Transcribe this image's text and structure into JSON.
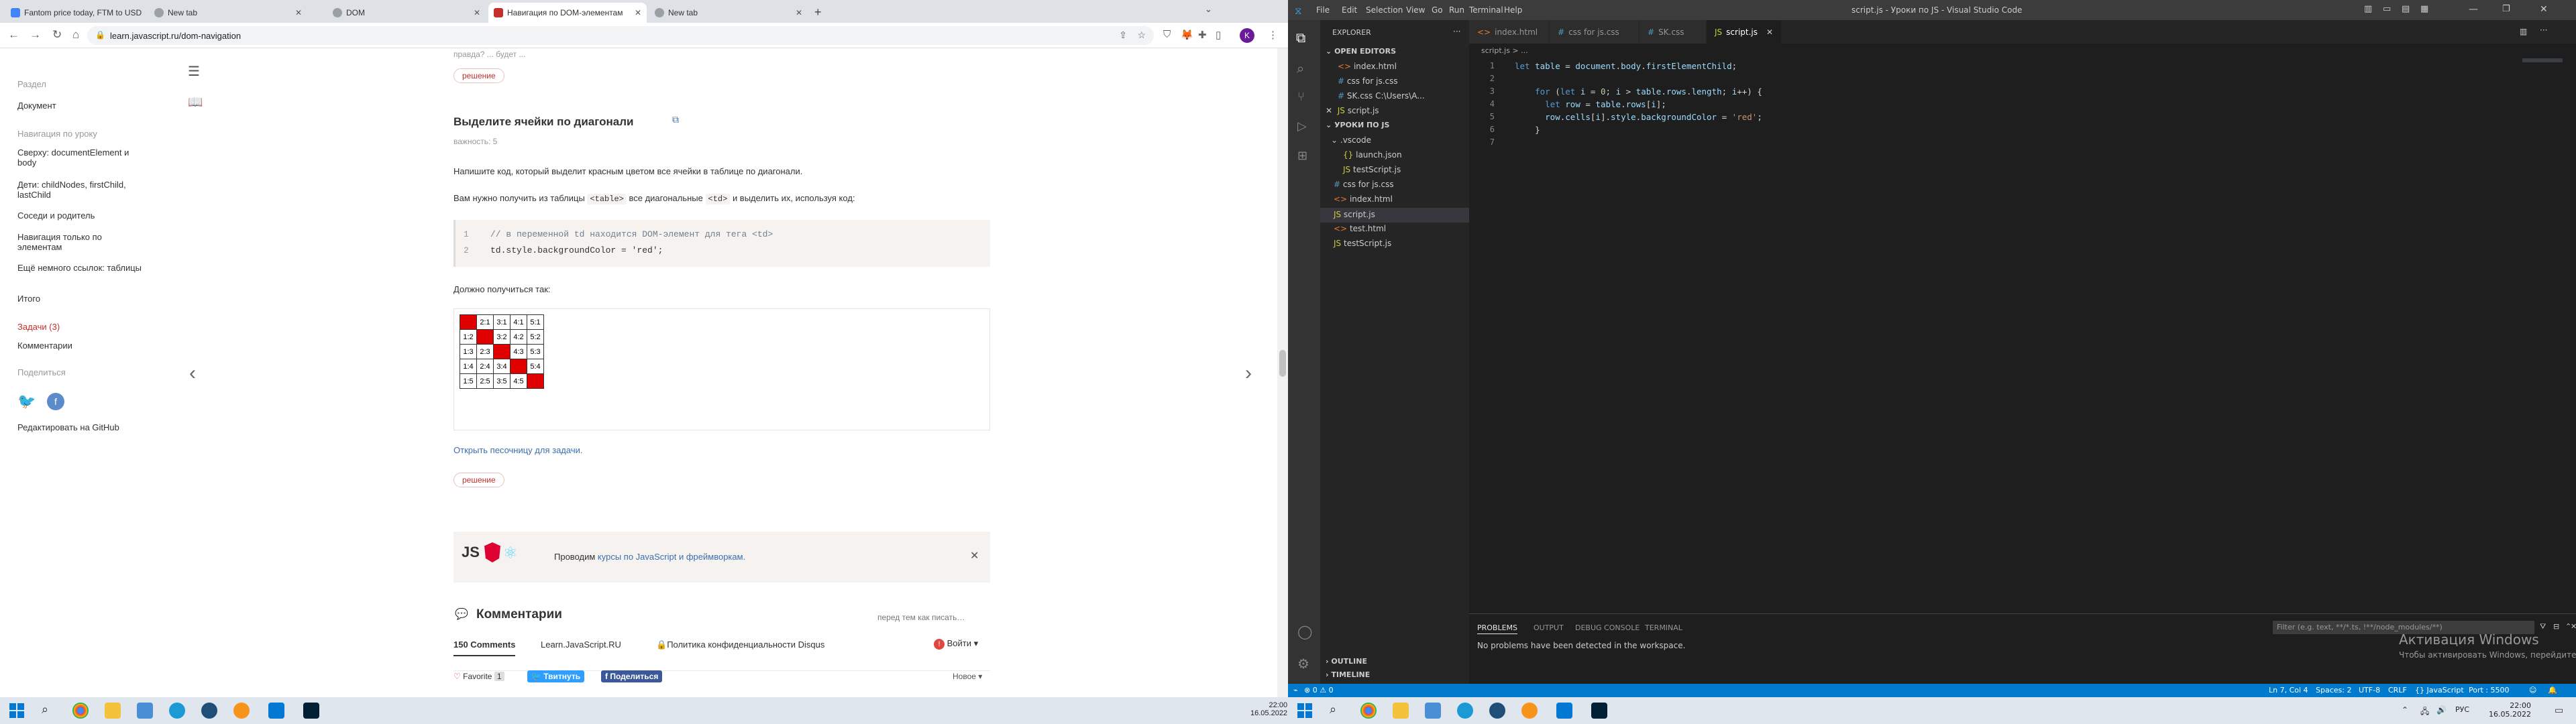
{
  "browser": {
    "tabs": [
      {
        "title": "Fantom price today, FTM to USD",
        "fav_color": "#4285f4"
      },
      {
        "title": "New tab",
        "fav_color": "#5f6368"
      },
      {
        "title": "DOM",
        "fav_color": "#5f6368"
      },
      {
        "title": "Навигация по DOM-элементам",
        "fav_color": "#c4302b"
      },
      {
        "title": "New tab",
        "fav_color": "#5f6368"
      }
    ],
    "new_tab": "+",
    "url": "learn.javascript.ru/dom-navigation",
    "profile_initial": "K"
  },
  "sidebar": {
    "section_head": "Раздел",
    "section_item": "Документ",
    "nav_head": "Навигация по уроку",
    "items": [
      "Сверху: documentElement и body",
      "Дети: childNodes, firstChild, lastChild",
      "Соседи и родитель",
      "Навигация только по элементам",
      "Ещё немного ссылок: таблицы",
      "Итого"
    ],
    "tasks": "Задачи (3)",
    "comments": "Комментарии",
    "share_head": "Поделиться",
    "github": "Редактировать на GitHub"
  },
  "article": {
    "top_snippet": "правда? ... будет ...",
    "solution_btn": "решение",
    "task_title": "Выделите ячейки по диагонали",
    "importance": "важность: 5",
    "para1": "Напишите код, который выделит красным цветом все ячейки в таблице по диагонали.",
    "para2_a": "Вам нужно получить из таблицы",
    "para2_code1": "<table>",
    "para2_b": "все диагональные",
    "para2_code2": "<td>",
    "para2_c": "и выделить их, используя код:",
    "code_lines": [
      {
        "n": "1",
        "text": "// в переменной td находится DOM-элемент для тега <td>"
      },
      {
        "n": "2",
        "text": "td.style.backgroundColor = 'red';"
      }
    ],
    "should_be": "Должно получиться так:",
    "sandbox_link": "Открыть песочницу для задачи.",
    "solution_btn2": "решение",
    "ad_prefix": "Проводим",
    "ad_link": "курсы по JavaScript и фреймворкам.",
    "comments_title": "Комментарии",
    "comments_hint": "перед тем как писать…",
    "comments_count": "150 Comments",
    "disqus_site": "Learn.JavaScript.RU",
    "privacy": "Политика конфиденциальности Disqus",
    "login": "Войти",
    "favorite": "Favorite",
    "favorite_count": "1",
    "tweet": "Твитнуть",
    "share": "Поделиться",
    "sort": "Новое"
  },
  "diag_table": [
    [
      "1:1",
      "2:1",
      "3:1",
      "4:1",
      "5:1"
    ],
    [
      "1:2",
      "2:2",
      "3:2",
      "4:2",
      "5:2"
    ],
    [
      "1:3",
      "2:3",
      "3:3",
      "4:3",
      "5:3"
    ],
    [
      "1:4",
      "2:4",
      "3:4",
      "4:4",
      "5:4"
    ],
    [
      "1:5",
      "2:5",
      "3:5",
      "4:5",
      "5:5"
    ]
  ],
  "taskbar_left": {
    "time": "22:00",
    "date": "16.05.2022"
  },
  "vscode": {
    "title": "script.js - Уроки по JS - Visual Studio Code",
    "menu": [
      "File",
      "Edit",
      "Selection",
      "View",
      "Go",
      "Run",
      "Terminal",
      "Help"
    ],
    "explorer_title": "EXPLORER",
    "open_editors_title": "OPEN EDITORS",
    "open_editors": [
      "index.html",
      "css for js.css",
      "SK.css C:\\Users\\A...",
      "script.js"
    ],
    "folder_title": "УРОКИ ПО JS",
    "tree": [
      ".vscode",
      "launch.json",
      "testScript.js",
      "css for js.css",
      "index.html",
      "script.js",
      "test.html",
      "testScript.js"
    ],
    "editor_tabs": [
      "index.html",
      "css for js.css",
      "SK.css",
      "script.js"
    ],
    "breadcrumb": "script.js > ...",
    "code": [
      {
        "n": "1",
        "html": "<span class='kw'>let</span> <span class='vr'>table</span> = <span class='vr'>document</span>.<span class='vr'>body</span>.<span class='vr'>firstElementChild</span>;"
      },
      {
        "n": "2",
        "html": ""
      },
      {
        "n": "3",
        "html": "    <span class='kw'>for</span> (<span class='kw'>let</span> <span class='vr'>i</span> = <span class='nu'>0</span>; <span class='vr'>i</span> &gt; <span class='vr'>table</span>.<span class='vr'>rows</span>.<span class='vr'>length</span>; <span class='vr'>i</span>++) {"
      },
      {
        "n": "4",
        "html": "      <span class='kw'>let</span> <span class='vr'>row</span> = <span class='vr'>table</span>.<span class='vr'>rows</span>[<span class='vr'>i</span>];"
      },
      {
        "n": "5",
        "html": "      <span class='vr'>row</span>.<span class='vr'>cells</span>[<span class='vr'>i</span>].<span class='vr'>style</span>.<span class='vr'>backgroundColor</span> = <span class='st'>'red'</span>;"
      },
      {
        "n": "6",
        "html": "    }"
      },
      {
        "n": "7",
        "html": ""
      }
    ],
    "panel_tabs": [
      "PROBLEMS",
      "OUTPUT",
      "DEBUG CONSOLE",
      "TERMINAL"
    ],
    "panel_filter": "Filter (e.g. text, **/*.ts, !**/node_modules/**)",
    "panel_msg": "No problems have been detected in the workspace.",
    "outline": "OUTLINE",
    "timeline": "TIMELINE",
    "status_left": "⊗ 0 ⚠ 0",
    "status_right": [
      "Ln 7, Col 4",
      "Spaces: 2",
      "UTF-8",
      "CRLF",
      "{} JavaScript",
      "Port : 5500"
    ],
    "activation_title": "Активация Windows",
    "activation_sub": "Чтобы активировать Windows, перейдите в раздел \"Параметры\"."
  },
  "taskbar_right": {
    "lang": "РУС",
    "time": "22:00",
    "date": "16.05.2022"
  }
}
